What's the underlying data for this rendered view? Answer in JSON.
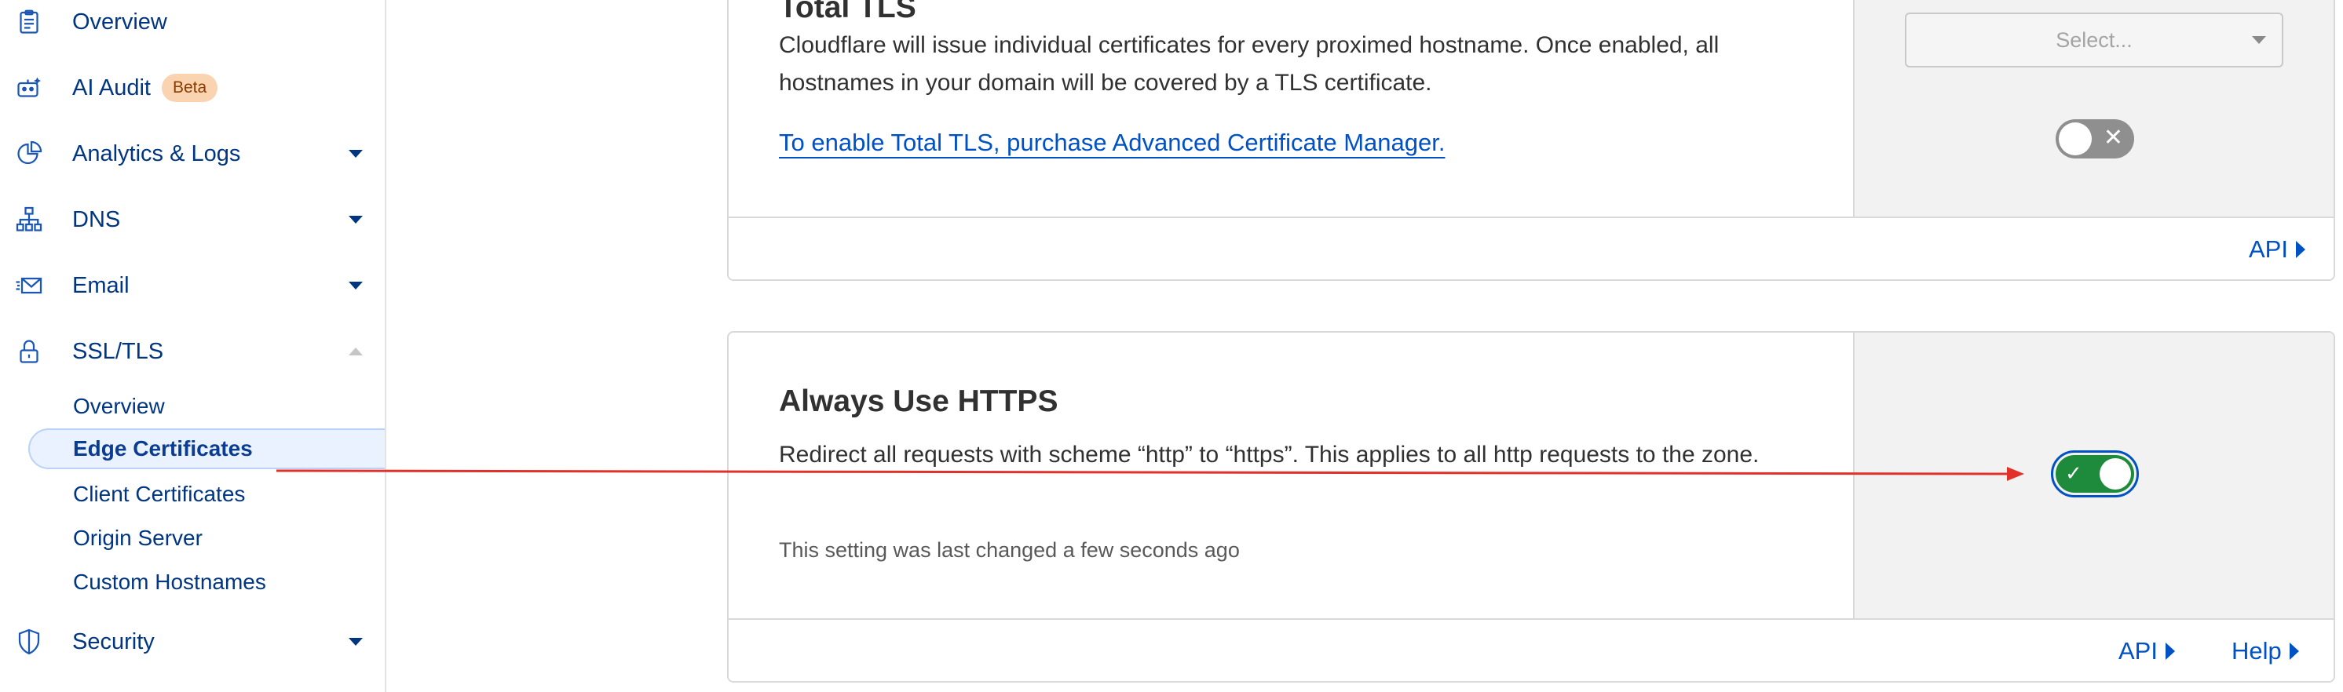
{
  "sidebar": {
    "items": [
      {
        "label": "Overview",
        "icon": "clipboard-icon"
      },
      {
        "label": "AI Audit",
        "icon": "robot-icon",
        "badge": "Beta"
      },
      {
        "label": "Analytics & Logs",
        "icon": "pie-chart-icon"
      },
      {
        "label": "DNS",
        "icon": "network-icon"
      },
      {
        "label": "Email",
        "icon": "envelope-icon"
      },
      {
        "label": "SSL/TLS",
        "icon": "lock-icon"
      },
      {
        "label": "Security",
        "icon": "shield-icon"
      }
    ],
    "ssl_subitems": [
      "Overview",
      "Edge Certificates",
      "Client Certificates",
      "Origin Server",
      "Custom Hostnames"
    ],
    "active_subitem": "Edge Certificates"
  },
  "total_tls": {
    "title": "Total TLS",
    "description": "Cloudflare will issue individual certificates for every proximed hostname. Once enabled, all hostnames in your domain will be covered by a TLS certificate.",
    "link": "To enable Total TLS, purchase Advanced Certificate Manager.",
    "select_placeholder": "Select...",
    "toggle_state": "off",
    "footer_api": "API"
  },
  "always_https": {
    "title": "Always Use HTTPS",
    "description": "Redirect all requests with scheme “http” to “https”. This applies to all http requests to the zone.",
    "last_changed": "This setting was last changed a few seconds ago",
    "toggle_state": "on",
    "footer_api": "API",
    "footer_help": "Help"
  },
  "colors": {
    "link": "#0051c3",
    "nav_text": "#003681",
    "toggle_on": "#1e8a3b",
    "toggle_off": "#8f8f8f",
    "annotation_arrow": "#e0322b",
    "badge_bg": "#fad4b1"
  }
}
